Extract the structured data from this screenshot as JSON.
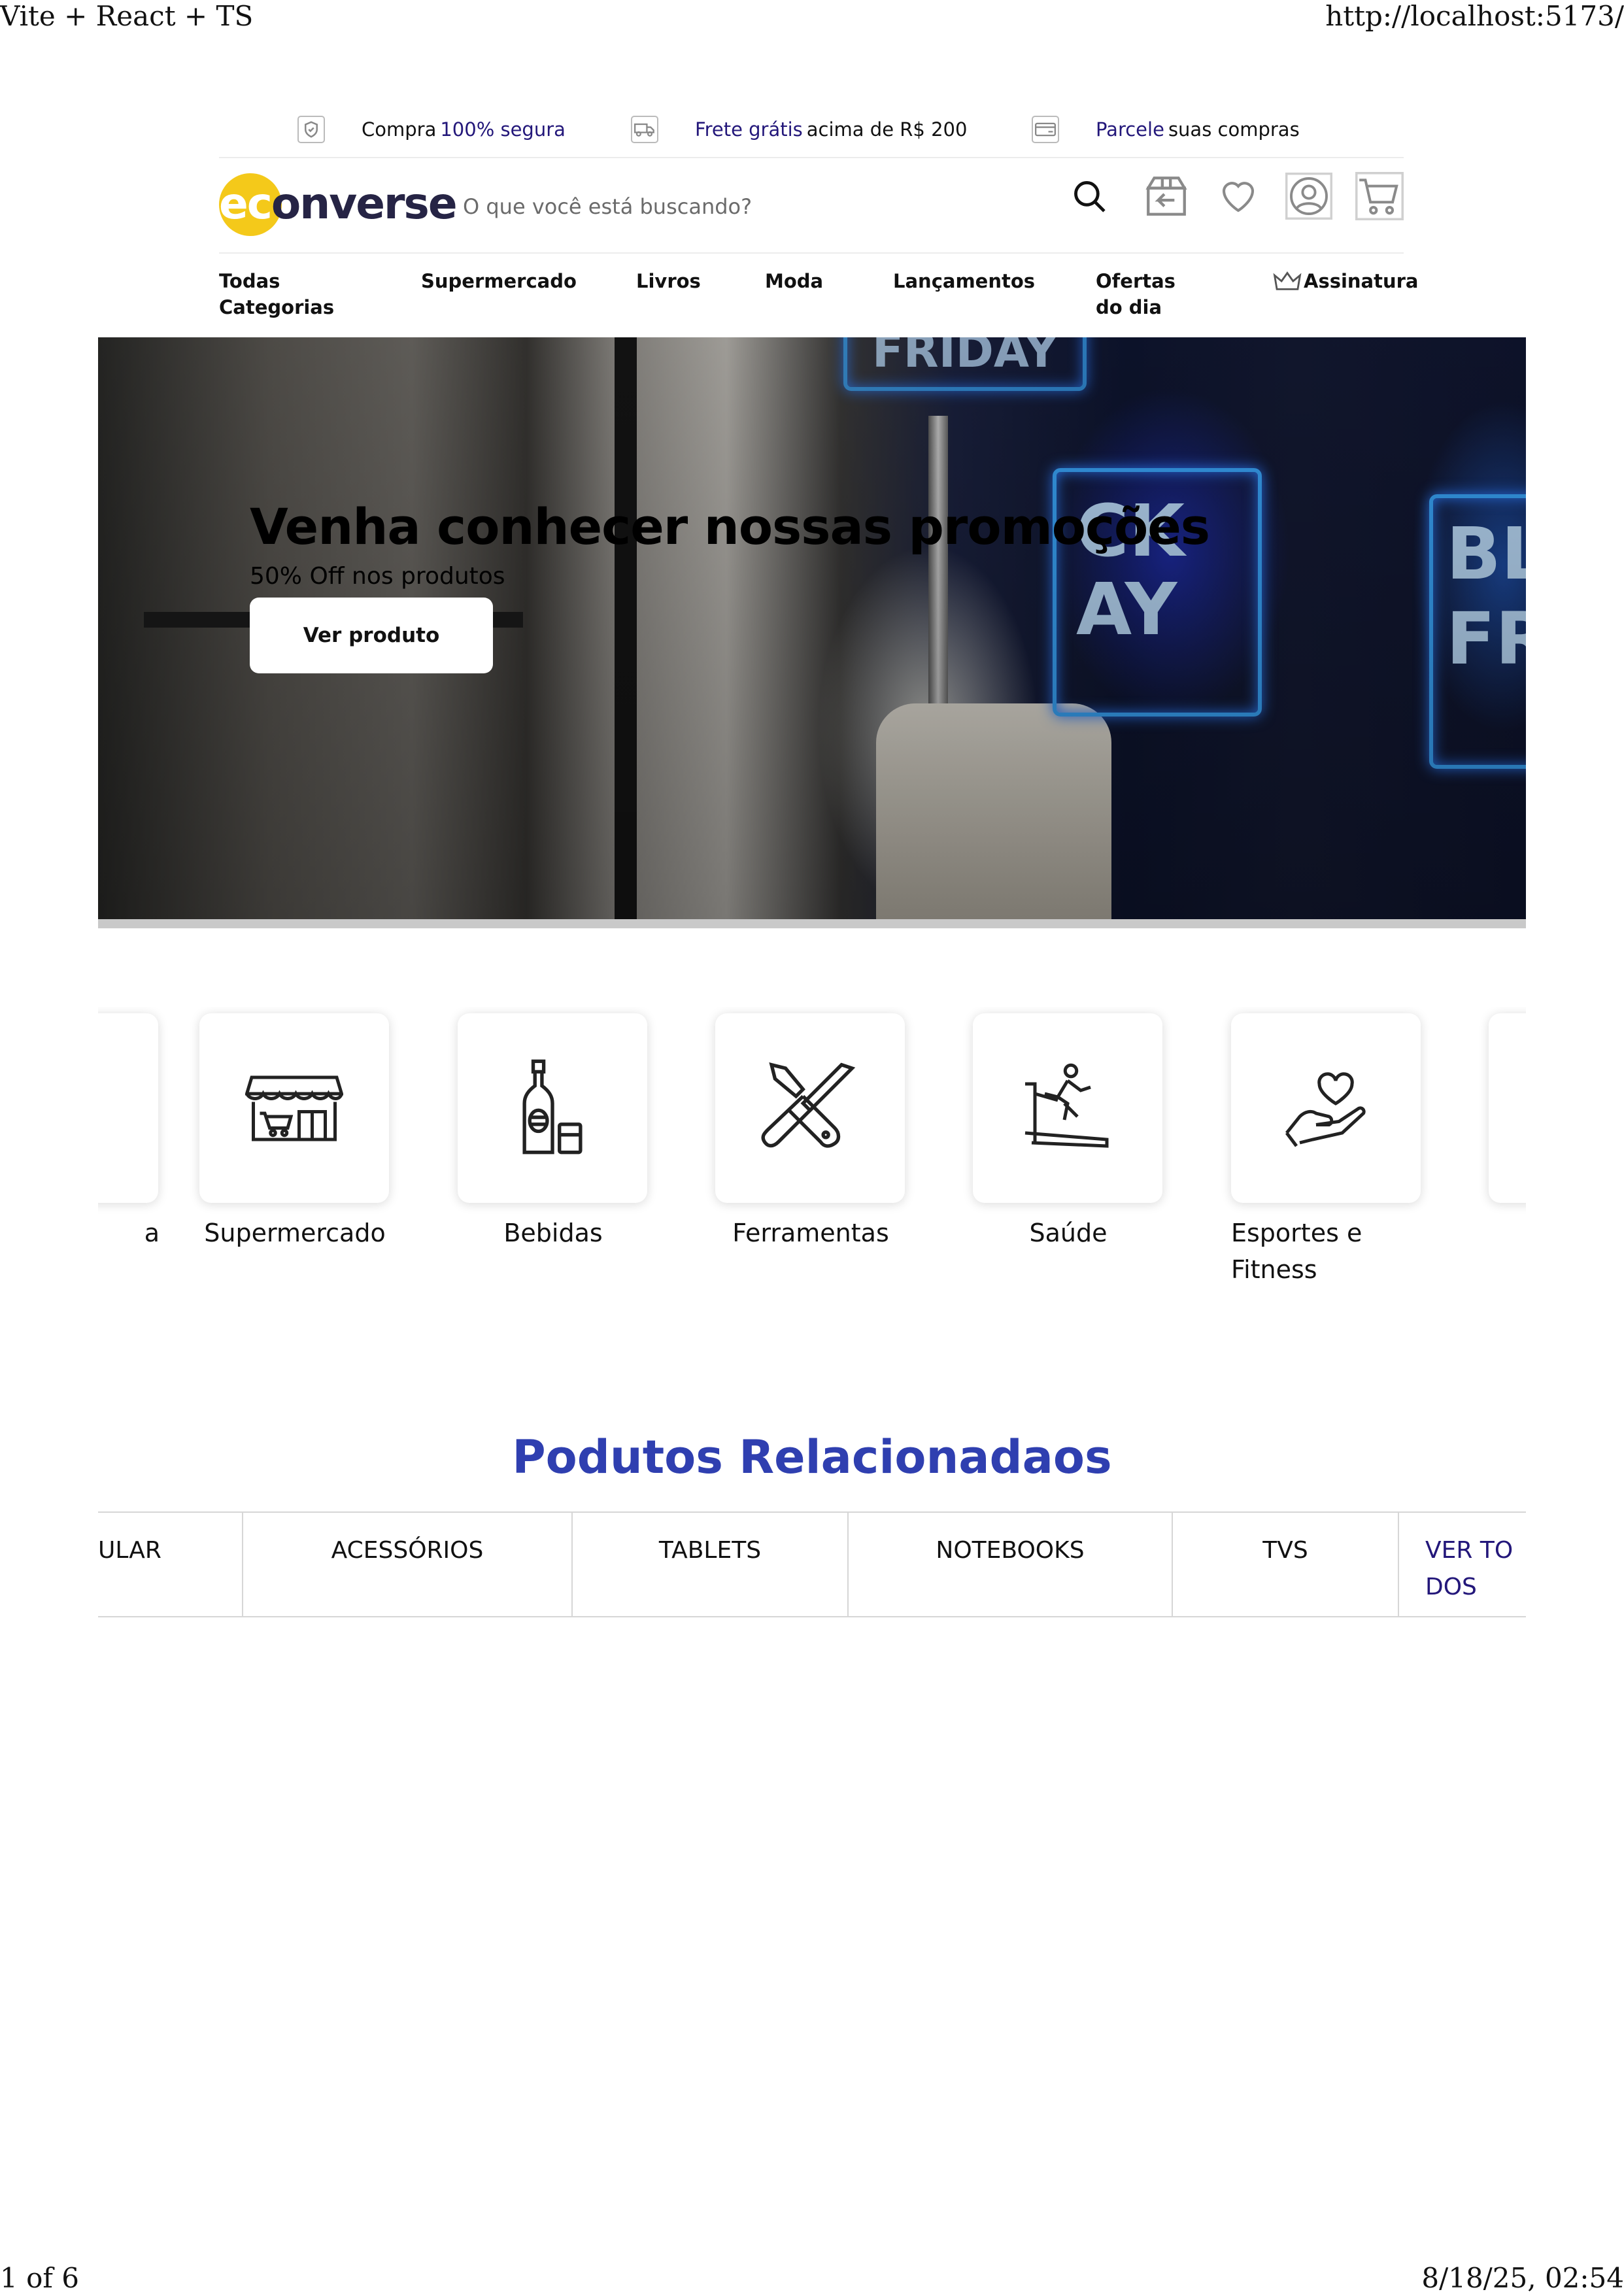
{
  "print": {
    "title": "Vite + React + TS",
    "url": "http://localhost:5173/",
    "page": "1 of 6",
    "datetime": "8/18/25, 02:54"
  },
  "topbar": {
    "secure": {
      "text": "Compra ",
      "accent": "100% segura",
      "icon": "shield-check-icon"
    },
    "shipping": {
      "accent": "Frete grátis",
      "text": " acima de R$ 200",
      "icon": "truck-icon"
    },
    "installments": {
      "accent": "Parcele",
      "text": " suas compras",
      "icon": "credit-card-icon"
    }
  },
  "header": {
    "logo_ec": "ec",
    "logo_rest": "onverse",
    "search_placeholder": "O que você está buscando?",
    "icons": [
      "search-icon",
      "returns-box-icon",
      "heart-icon",
      "user-icon",
      "cart-icon"
    ]
  },
  "nav": {
    "all_categories": "Todas Categorias",
    "supermarket": "Supermercado",
    "books": "Livros",
    "fashion": "Moda",
    "releases": "Lançamentos",
    "deals": "Ofertas do dia",
    "subscription": "Assinatura"
  },
  "hero": {
    "title": "Venha conhecer nossas promoções",
    "subtitle": "50% Off nos produtos",
    "button": "Ver produto"
  },
  "categories": [
    {
      "label": "a",
      "icon": "category-icon"
    },
    {
      "label": "Supermercado",
      "icon": "store-icon"
    },
    {
      "label": "Bebidas",
      "icon": "bottle-icon"
    },
    {
      "label": "Ferramentas",
      "icon": "tools-icon"
    },
    {
      "label": "Saúde",
      "icon": "treadmill-icon"
    },
    {
      "label": "Esportes e Fitness",
      "icon": "heart-hand-icon"
    }
  ],
  "related": {
    "title": "Podutos Relacionadaos",
    "tabs": [
      "ULAR",
      "ACESSÓRIOS",
      "TABLETS",
      "NOTEBOOKS",
      "TVS"
    ],
    "view_all": "VER TODOS"
  },
  "colors": {
    "accent": "#23177a",
    "logo_yellow": "#f4c91a",
    "logo_dark": "#262445",
    "section_title": "#2f3fb0"
  }
}
